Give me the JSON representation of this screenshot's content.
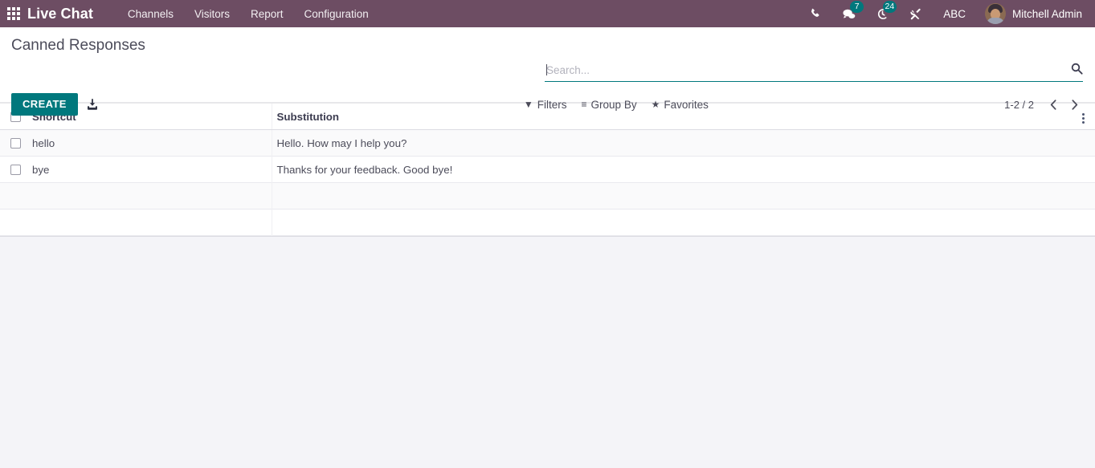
{
  "navbar": {
    "apps_icon": "apps-grid-icon",
    "brand": "Live Chat",
    "menu": [
      {
        "label": "Channels"
      },
      {
        "label": "Visitors"
      },
      {
        "label": "Report"
      },
      {
        "label": "Configuration"
      }
    ],
    "sysicons": [
      {
        "name": "phone-icon",
        "badge": ""
      },
      {
        "name": "messages-icon",
        "badge": "7"
      },
      {
        "name": "activities-clock-icon",
        "badge": "24"
      },
      {
        "name": "developer-tools-icon",
        "badge": ""
      }
    ],
    "abc_label": "ABC",
    "user": {
      "name": "Mitchell Admin",
      "avatar": "user-avatar"
    },
    "colors": {
      "navbar_bg": "#6d4d63",
      "badge_bg": "#00787d"
    }
  },
  "control_panel": {
    "title": "Canned Responses",
    "create_label": "CREATE",
    "import_icon": "import-download-icon",
    "search": {
      "value": "",
      "placeholder": "Search..."
    },
    "search_icon": "search-magnifier-icon",
    "filters": [
      {
        "label": "Filters",
        "icon": "filter-funnel-icon"
      },
      {
        "label": "Group By",
        "icon": "group-lines-icon"
      },
      {
        "label": "Favorites",
        "icon": "star-icon"
      }
    ],
    "pager": {
      "count": "1-2 / 2",
      "prev_icon": "chevron-left-icon",
      "next_icon": "chevron-right-icon"
    },
    "colors": {
      "accent": "#00787d"
    }
  },
  "list": {
    "columns": [
      {
        "key": "shortcut",
        "label": "Shortcut"
      },
      {
        "key": "substitution",
        "label": "Substitution"
      }
    ],
    "optional_columns_icon": "kebab-menu-icon",
    "select_all": false,
    "rows": [
      {
        "selected": false,
        "shortcut": "hello",
        "substitution": "Hello. How may I help you?"
      },
      {
        "selected": false,
        "shortcut": "bye",
        "substitution": "Thanks for your feedback. Good bye!"
      }
    ]
  }
}
